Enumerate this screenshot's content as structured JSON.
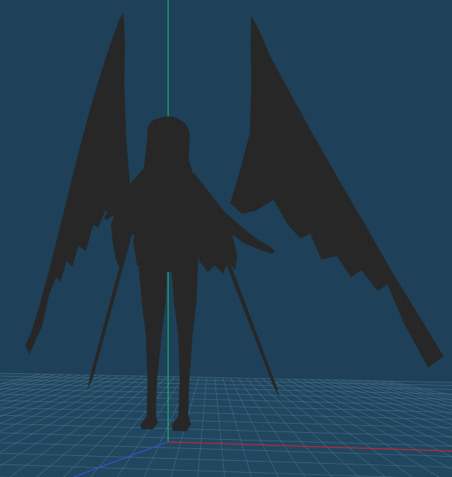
{
  "viewport": {
    "background_color": "#1e4058",
    "silhouette_color": "#272727",
    "grid": {
      "visible": true,
      "line_color": "#4d7690",
      "floor_color": "#21475f"
    },
    "axes": {
      "x_axis_color": "#c0283a",
      "y_axis_color": "#21c46a",
      "z_axis_color": "#3a4ed8"
    },
    "model": {
      "type": "winged-character-silhouette"
    }
  }
}
